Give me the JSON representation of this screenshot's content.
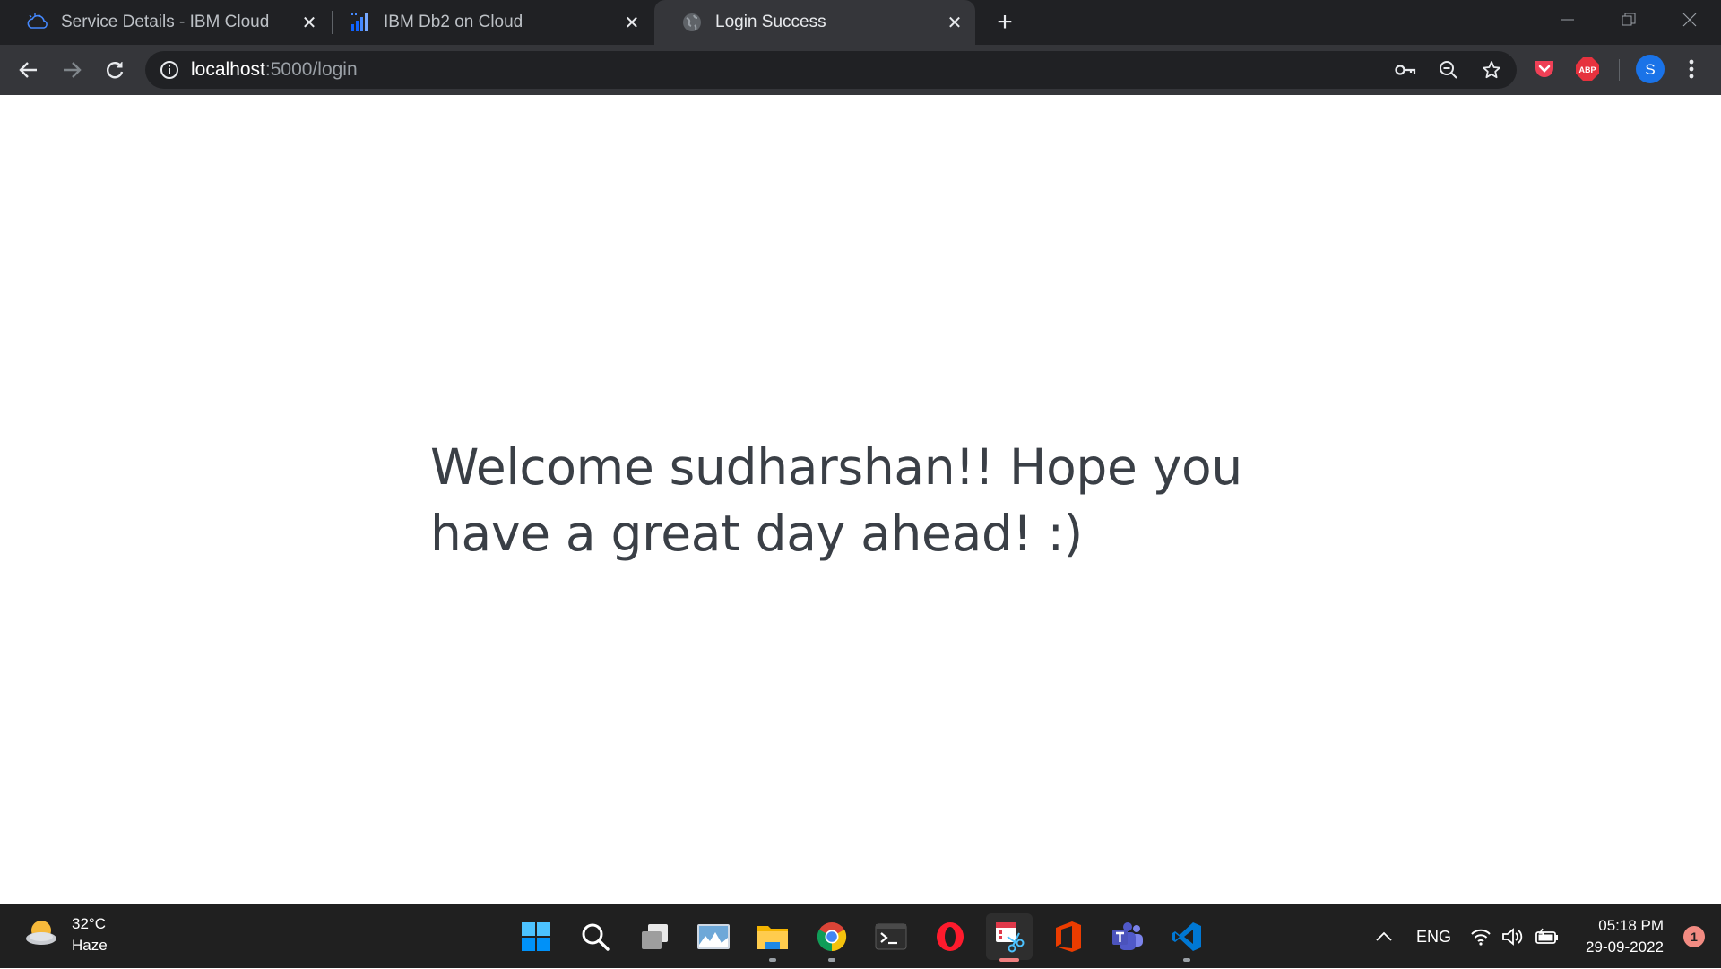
{
  "browser": {
    "tabs": [
      {
        "title": "Service Details - IBM Cloud",
        "icon": "ibm-cloud-icon",
        "active": false
      },
      {
        "title": "IBM Db2 on Cloud",
        "icon": "db2-icon",
        "active": false
      },
      {
        "title": "Login Success",
        "icon": "globe-icon",
        "active": true
      }
    ],
    "address": {
      "host": "localhost",
      "path": ":5000/login"
    },
    "profile_initial": "S",
    "extensions": [
      "pocket-icon",
      "adblock-plus-icon"
    ],
    "abp_label": "ABP"
  },
  "page": {
    "message": "Welcome sudharshan!! Hope you have a great day ahead! :)"
  },
  "taskbar": {
    "weather": {
      "temperature": "32°C",
      "condition": "Haze"
    },
    "apps": [
      "windows-start-icon",
      "search-icon",
      "task-view-icon",
      "photos-icon",
      "file-explorer-icon",
      "chrome-icon",
      "terminal-icon",
      "opera-icon",
      "snipping-tool-icon",
      "office-icon",
      "teams-icon",
      "vscode-icon"
    ],
    "language": "ENG",
    "time": "05:18 PM",
    "date": "29-09-2022",
    "notification_count": "1"
  },
  "colors": {
    "accent_blue": "#0078d4",
    "profile": "#1a73e8",
    "page_text": "#3a3f46"
  }
}
